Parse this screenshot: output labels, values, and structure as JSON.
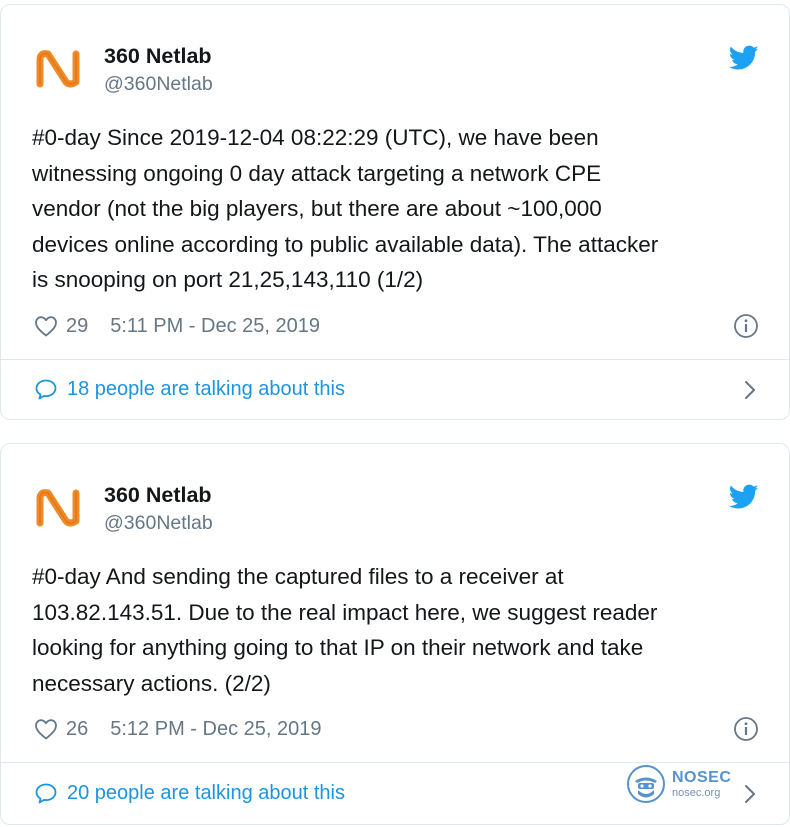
{
  "colors": {
    "accent": "#1da1f2",
    "link": "#1b95e0",
    "muted": "#657786",
    "text": "#14171a",
    "border": "#e1e8ed",
    "avatar_orange": "#f08a24",
    "watermark_blue": "#3b7fc4"
  },
  "icons": {
    "avatar": "netlab-logo",
    "brand": "twitter-bird-icon",
    "like": "heart-outline-icon",
    "info": "info-circle-icon",
    "replies": "speech-bubble-icon",
    "expand": "chevron-right-icon"
  },
  "tweets": [
    {
      "author_name": "360 Netlab",
      "author_handle": "@360Netlab",
      "text_lines": [
        "#0-day Since 2019-12-04 08:22:29 (UTC), we have been",
        "witnessing ongoing 0 day attack targeting a network CPE",
        "vendor (not the big players, but there are about ~100,000",
        "devices online according to public available data). The attacker",
        "is snooping on port 21,25,143,110 (1/2)"
      ],
      "likes": "29",
      "timestamp": "5:11 PM - Dec 25, 2019",
      "talking": "18 people are talking about this"
    },
    {
      "author_name": "360 Netlab",
      "author_handle": "@360Netlab",
      "text_lines": [
        "#0-day And sending the captured files to a receiver at",
        "103.82.143.51. Due to the real impact here, we suggest reader",
        "looking for anything going to that IP on their network and take",
        "necessary actions. (2/2)"
      ],
      "likes": "26",
      "timestamp": "5:12 PM - Dec 25, 2019",
      "talking": "20 people are talking about this"
    }
  ],
  "watermark": {
    "brand": "NOSEC",
    "site": "nosec.org"
  }
}
